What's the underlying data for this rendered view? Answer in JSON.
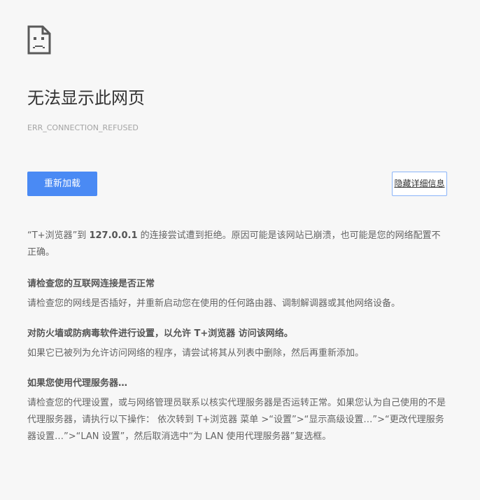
{
  "error_page": {
    "title": "无法显示此网页",
    "error_code": "ERR_CONNECTION_REFUSED",
    "reload_label": "重新加载",
    "details_label": "隐藏详细信息",
    "intro_prefix": "“T+浏览器”到 ",
    "intro_host": "127.0.0.1",
    "intro_suffix": " 的连接尝试遭到拒绝。原因可能是该网站已崩溃，也可能是您的网络配置不正确。",
    "sections": [
      {
        "heading": "请检查您的互联网连接是否正常",
        "body": "请检查您的网线是否插好，并重新启动您在使用的任何路由器、调制解调器或其他网络设备。"
      },
      {
        "heading": "对防火墙或防病毒软件进行设置，以允许 T+浏览器 访问该网络。",
        "body": "如果它已被列为允许访问网络的程序，请尝试将其从列表中删除，然后再重新添加。"
      },
      {
        "heading": "如果您使用代理服务器…",
        "body": "请检查您的代理设置，或与网络管理员联系以核实代理服务器是否运转正常。如果您认为自己使用的不是代理服务器，请执行以下操作： 依次转到 T+浏览器 菜单 >“设置”>“显示高级设置…”>“更改代理服务器设置…”>“LAN 设置”，然后取消选中“为 LAN 使用代理服务器”复选框。"
      }
    ]
  },
  "colors": {
    "background": "#f7f7f7",
    "button_primary": "#4a8af4",
    "details_border": "#8ab4f8",
    "title": "#333333",
    "body_text": "#646464",
    "error_code": "#a4a4a4"
  },
  "icons": {
    "main": "sad-page-icon"
  }
}
